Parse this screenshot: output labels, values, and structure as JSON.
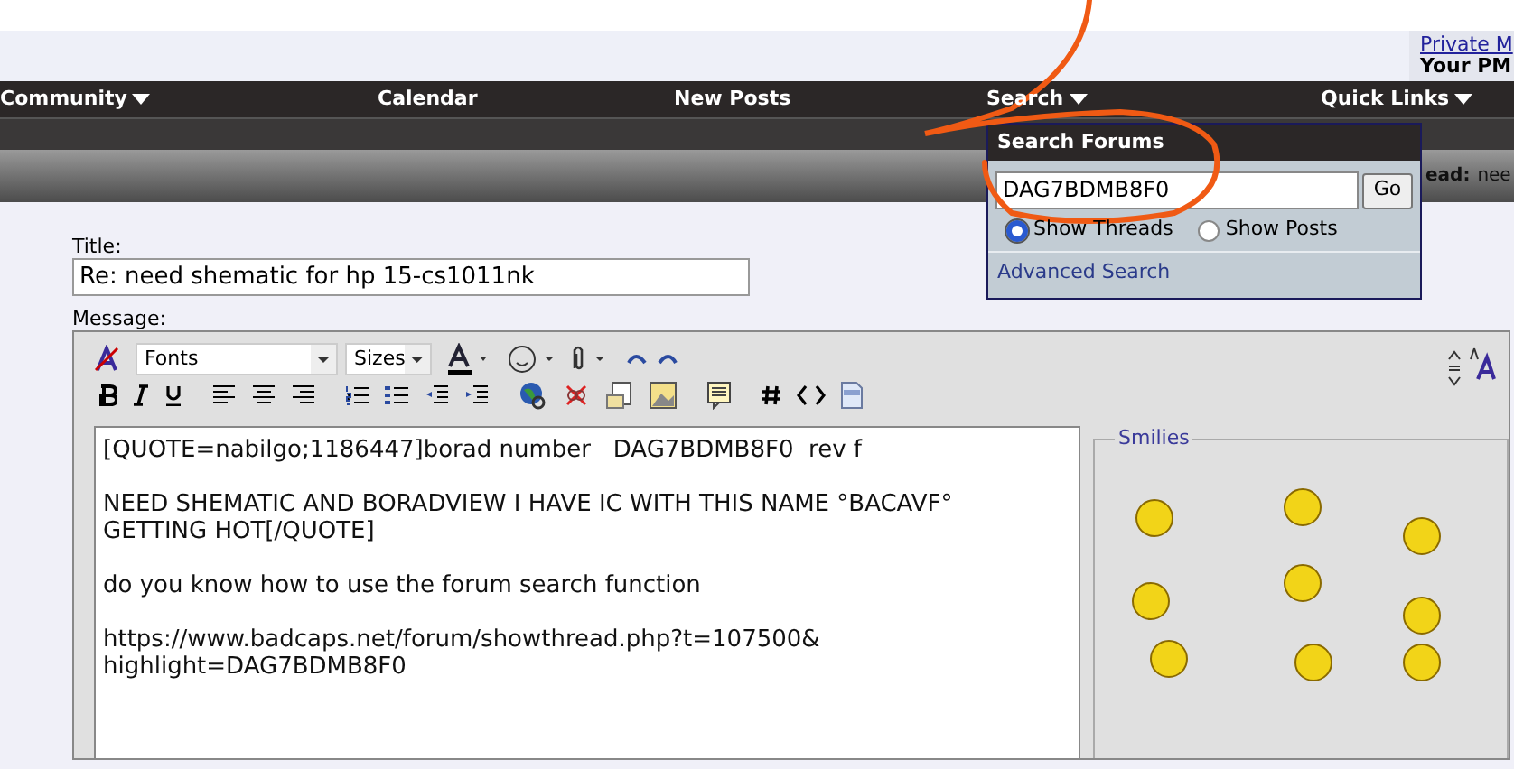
{
  "pm": {
    "link": "Private M",
    "label": "Your PM"
  },
  "nav": [
    {
      "label": "Community",
      "dropdown": true
    },
    {
      "label": "Calendar",
      "dropdown": false
    },
    {
      "label": "New Posts",
      "dropdown": false
    },
    {
      "label": "Search",
      "dropdown": true
    },
    {
      "label": "Quick Links",
      "dropdown": true
    }
  ],
  "thread_bar": {
    "label": "ead:",
    "value": "nee"
  },
  "search_popup": {
    "title": "Search Forums",
    "query": "DAG7BDMB8F0",
    "go": "Go",
    "options": [
      {
        "label": "Show Threads",
        "selected": true
      },
      {
        "label": "Show Posts",
        "selected": false
      }
    ],
    "advanced": "Advanced Search"
  },
  "title": {
    "label": "Title:",
    "value": "Re: need shematic for hp 15-cs1011nk"
  },
  "message": {
    "label": "Message:",
    "font": "Fonts",
    "size": "Sizes",
    "text": "[QUOTE=nabilgo;1186447]borad number   DAG7BDMB8F0  rev f\n\nNEED SHEMATIC AND BORADVIEW I HAVE IC WITH THIS NAME °BACAVF°\nGETTING HOT[/QUOTE]\n\ndo you know how to use the forum search function\n\nhttps://www.badcaps.net/forum/showthread.php?t=107500&\nhighlight=DAG7BDMB8F0"
  },
  "smilies": {
    "legend": "Smilies"
  }
}
